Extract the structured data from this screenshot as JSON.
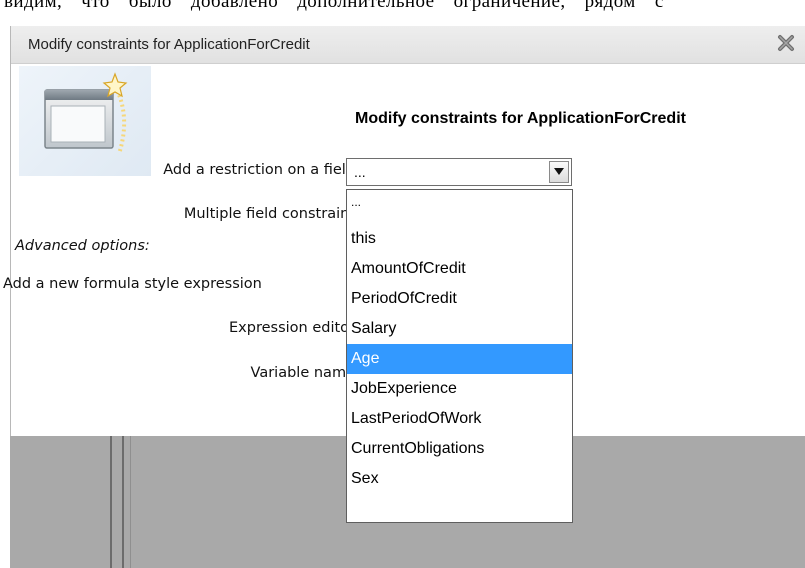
{
  "background_text": "видим, что было добавлено дополнительное ограничение, рядом с",
  "dialog": {
    "title": "Modify constraints for ApplicationForCredit",
    "heading": "Modify constraints for ApplicationForCredit",
    "close_icon": "close-x-icon",
    "wizard_icon": "wizard-window-star-icon"
  },
  "form": {
    "restriction_label": "Add a restriction on a field",
    "multiple_label": "Multiple field constraint",
    "advanced_heading": "Advanced options:",
    "formula_label": "Add a new formula style expression",
    "expression_label": "Expression editor",
    "variable_label": "Variable name"
  },
  "field_select": {
    "value": "...",
    "arrow_icon": "dropdown-arrow-icon"
  },
  "dropdown": {
    "options": [
      "...",
      "this",
      "AmountOfCredit",
      "PeriodOfCredit",
      "Salary",
      "Age",
      "JobExperience",
      "LastPeriodOfWork",
      "CurrentObligations",
      "Sex"
    ],
    "highlighted": "Age"
  },
  "colors": {
    "highlight": "#3399ff",
    "titlebar": "#e6e6e6",
    "background_grey": "#a9a9a9"
  }
}
